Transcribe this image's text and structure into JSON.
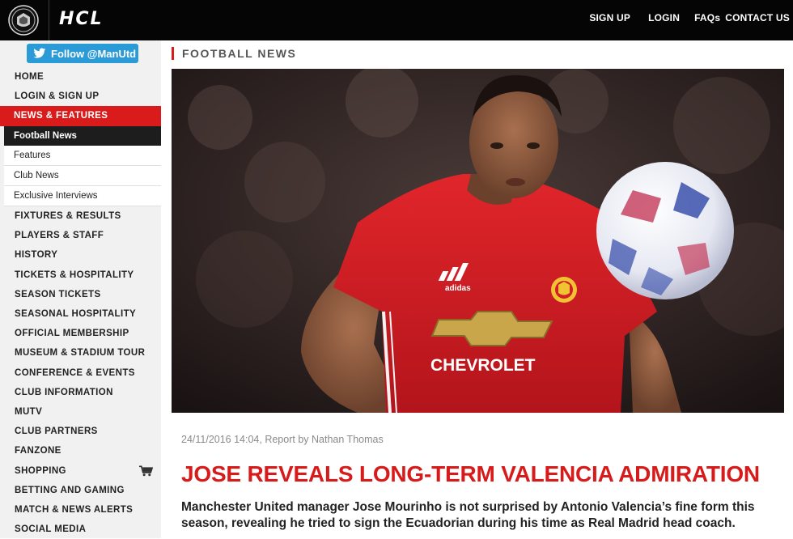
{
  "header": {
    "crest_icon": "club-crest-icon",
    "sponsor_logo": "HCL",
    "nav": [
      {
        "label": "SIGN UP"
      },
      {
        "label": "LOGIN"
      },
      {
        "label": "FAQs"
      },
      {
        "label": "CONTACT US"
      }
    ]
  },
  "sidebar": {
    "follow_label": "Follow @ManUtd",
    "follow_icon": "twitter-bird-icon",
    "items": [
      {
        "label": "HOME"
      },
      {
        "label": "LOGIN & SIGN UP"
      },
      {
        "label": "NEWS & FEATURES"
      },
      {
        "label": "Football News"
      },
      {
        "label": "Features"
      },
      {
        "label": "Club News"
      },
      {
        "label": "Exclusive Interviews"
      },
      {
        "label": "FIXTURES & RESULTS"
      },
      {
        "label": "PLAYERS & STAFF"
      },
      {
        "label": "HISTORY"
      },
      {
        "label": "TICKETS & HOSPITALITY"
      },
      {
        "label": "SEASON TICKETS"
      },
      {
        "label": "SEASONAL HOSPITALITY"
      },
      {
        "label": "OFFICIAL MEMBERSHIP"
      },
      {
        "label": "MUSEUM & STADIUM TOUR"
      },
      {
        "label": "CONFERENCE & EVENTS"
      },
      {
        "label": "CLUB INFORMATION"
      },
      {
        "label": "MUTV"
      },
      {
        "label": "CLUB PARTNERS"
      },
      {
        "label": "FANZONE"
      },
      {
        "label": "SHOPPING"
      },
      {
        "label": "BETTING AND GAMING"
      },
      {
        "label": "MATCH & NEWS ALERTS"
      },
      {
        "label": "SOCIAL MEDIA"
      }
    ],
    "shopping_icon": "shopping-cart-icon"
  },
  "main": {
    "section_title": "FOOTBALL NEWS",
    "hero": {
      "shirt_brand": "adidas",
      "shirt_sponsor": "CHEVROLET"
    },
    "meta": "24/11/2016 14:04, Report by Nathan Thomas",
    "headline": "JOSE REVEALS LONG-TERM VALENCIA ADMIRATION",
    "lede": "Manchester United manager Jose Mourinho is not surprised by Antonio Valencia’s fine form this season, revealing he tried to sign the Ecuadorian during his time as Real Madrid head coach."
  },
  "colors": {
    "brand_red": "#da1b1b",
    "header_bg": "#050505",
    "twitter_blue": "#2b9bd8",
    "sidebar_bg": "#f1f1f1"
  }
}
